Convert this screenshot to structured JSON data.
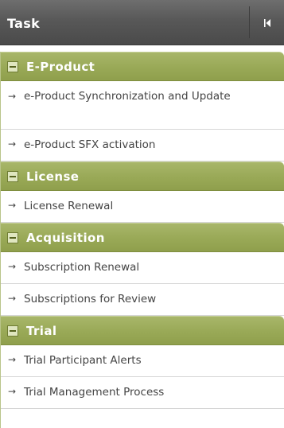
{
  "header": {
    "title": "Task",
    "collapse_icon": "collapse-left-icon"
  },
  "groups": [
    {
      "title": "E-Product",
      "toggle_icon": "minus-icon",
      "items": [
        {
          "label": "e-Product Synchronization and Update"
        },
        {
          "label": "e-Product SFX activation"
        }
      ]
    },
    {
      "title": "License",
      "toggle_icon": "minus-icon",
      "items": [
        {
          "label": "License Renewal"
        }
      ]
    },
    {
      "title": "Acquisition",
      "toggle_icon": "minus-icon",
      "items": [
        {
          "label": "Subscription Renewal"
        },
        {
          "label": "Subscriptions for Review"
        }
      ]
    },
    {
      "title": "Trial",
      "toggle_icon": "minus-icon",
      "items": [
        {
          "label": "Trial Participant Alerts"
        },
        {
          "label": "Trial Management Process"
        }
      ]
    }
  ],
  "colors": {
    "header_bg": "#585858",
    "group_header_bg": "#9aaa58",
    "item_bg": "#ffffff",
    "text": "#444444"
  },
  "arrow_glyph": "→"
}
